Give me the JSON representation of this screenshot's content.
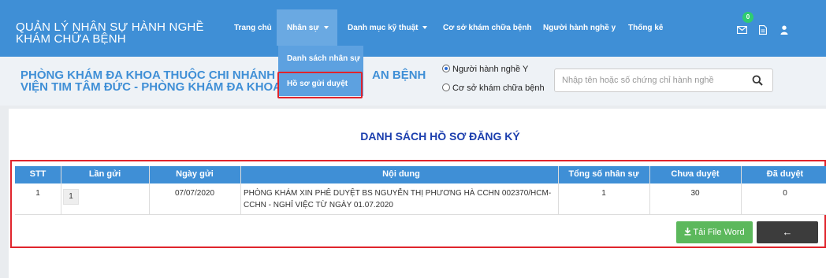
{
  "header": {
    "brand": "QUẢN LÝ NHÂN SỰ HÀNH NGHỀ KHÁM CHỮA BỆNH",
    "nav": {
      "home": "Trang chủ",
      "staff": "Nhân sự",
      "tech_catalog": "Danh mục kỹ thuật",
      "facility": "Cơ sở khám chữa bệnh",
      "practitioner": "Người hành nghề y",
      "stats": "Thống kê"
    },
    "notification_count": "0",
    "icons": [
      "envelope-icon",
      "document-icon",
      "user-icon"
    ],
    "color": "#3f8fd6"
  },
  "dropdown": {
    "items": [
      "Danh sách nhân sự",
      "Hồ sơ gửi duyệt"
    ],
    "selected": "Hồ sơ gửi duyệt"
  },
  "subheader": {
    "clinic_line1": "PHÒNG KHÁM ĐA KHOA THUỘC CHI NHÁNH C",
    "clinic_line1_tail": "AN BỆNH",
    "clinic_line2": "VIỆN TIM TÂM ĐỨC - PHÒNG KHÁM ĐA KHOA T",
    "radio_practitioner": "Người hành nghề Y",
    "radio_facility": "Cơ sở khám chữa bệnh",
    "search_placeholder": "Nhập tên hoặc số chứng chỉ hành nghề"
  },
  "main": {
    "title": "DANH SÁCH HỒ SƠ ĐĂNG KÝ",
    "columns": [
      "STT",
      "Lần gửi",
      "Ngày gửi",
      "Nội dung",
      "Tổng số nhân sự",
      "Chưa duyệt",
      "Đã duyệt"
    ],
    "rows": [
      {
        "stt": "1",
        "lan_gui": "1",
        "ngay_gui": "07/07/2020",
        "noi_dung": "PHÒNG KHÁM XIN PHÊ DUYỆT BS NGUYỄN THỊ PHƯƠNG HÀ CCHN 002370/HCM-CCHN - NGHỈ VIỆC TỪ NGÀY 01.07.2020",
        "tong_so": "1",
        "chua_duyet": "30",
        "da_duyet": "0"
      }
    ],
    "download_button": "Tải File Word",
    "back_button": "←"
  }
}
